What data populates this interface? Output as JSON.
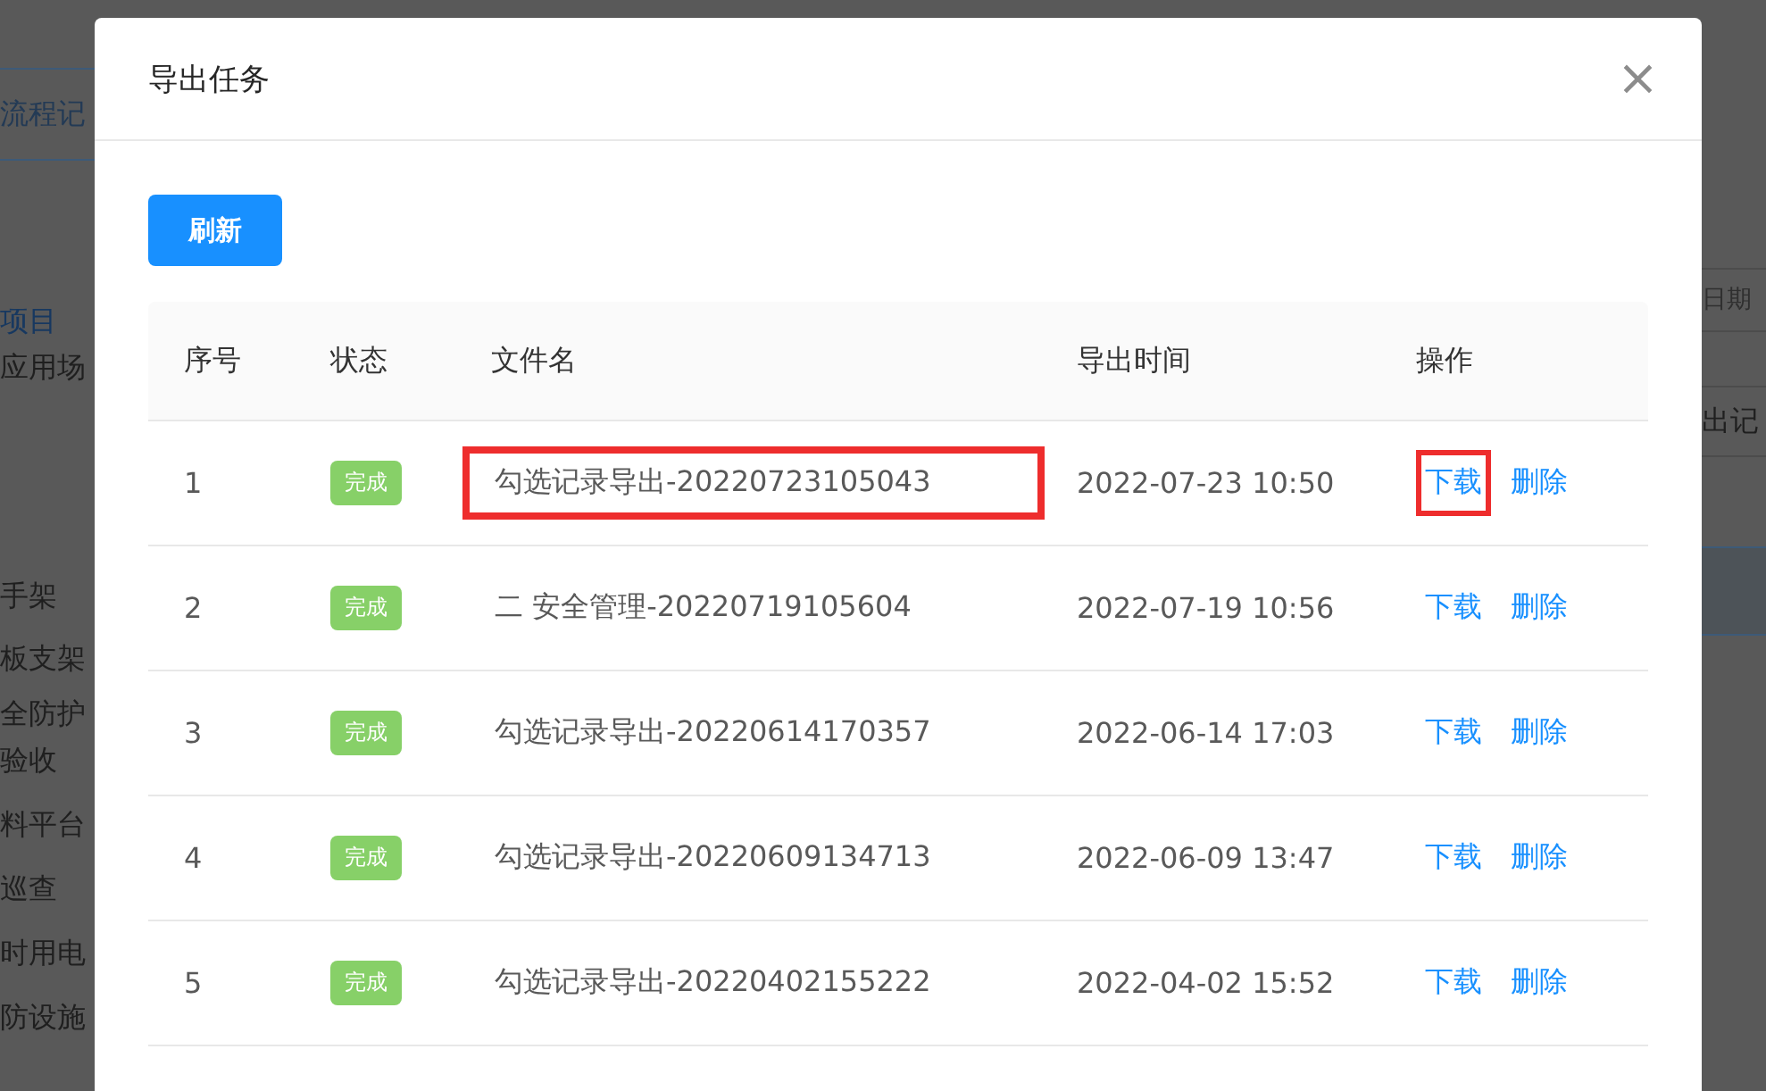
{
  "background": {
    "tab": "流程记",
    "left_items": [
      {
        "label": "项目",
        "selected": true
      },
      {
        "label": "应用场",
        "selected": false
      },
      {
        "label": "手架",
        "selected": false
      },
      {
        "label": "板支架",
        "selected": false
      },
      {
        "label": "全防护",
        "selected": false
      },
      {
        "label": "验收",
        "selected": false
      },
      {
        "label": "料平台",
        "selected": false
      },
      {
        "label": "巡查",
        "selected": false
      },
      {
        "label": "时用电",
        "selected": false
      },
      {
        "label": "防设施",
        "selected": false
      }
    ],
    "date_field": {
      "placeholder": "日期"
    },
    "right_button": "出记"
  },
  "dialog": {
    "title": "导出任务",
    "close": "×",
    "refresh_button": "刷新",
    "table": {
      "columns": [
        "序号",
        "状态",
        "文件名",
        "导出时间",
        "操作"
      ],
      "rows": [
        {
          "index": "1",
          "status": "完成",
          "filename": "勾选记录导出-20220723105043",
          "time": "2022-07-23 10:50",
          "download": "下载",
          "delete": "删除",
          "filename_highlighted": true,
          "download_highlighted": true
        },
        {
          "index": "2",
          "status": "完成",
          "filename": "二 安全管理-20220719105604",
          "time": "2022-07-19 10:56",
          "download": "下载",
          "delete": "删除",
          "filename_highlighted": false,
          "download_highlighted": false
        },
        {
          "index": "3",
          "status": "完成",
          "filename": "勾选记录导出-20220614170357",
          "time": "2022-06-14 17:03",
          "download": "下载",
          "delete": "删除",
          "filename_highlighted": false,
          "download_highlighted": false
        },
        {
          "index": "4",
          "status": "完成",
          "filename": "勾选记录导出-20220609134713",
          "time": "2022-06-09 13:47",
          "download": "下载",
          "delete": "删除",
          "filename_highlighted": false,
          "download_highlighted": false
        },
        {
          "index": "5",
          "status": "完成",
          "filename": "勾选记录导出-20220402155222",
          "time": "2022-04-02 15:52",
          "download": "下载",
          "delete": "删除",
          "filename_highlighted": false,
          "download_highlighted": false
        }
      ]
    }
  }
}
